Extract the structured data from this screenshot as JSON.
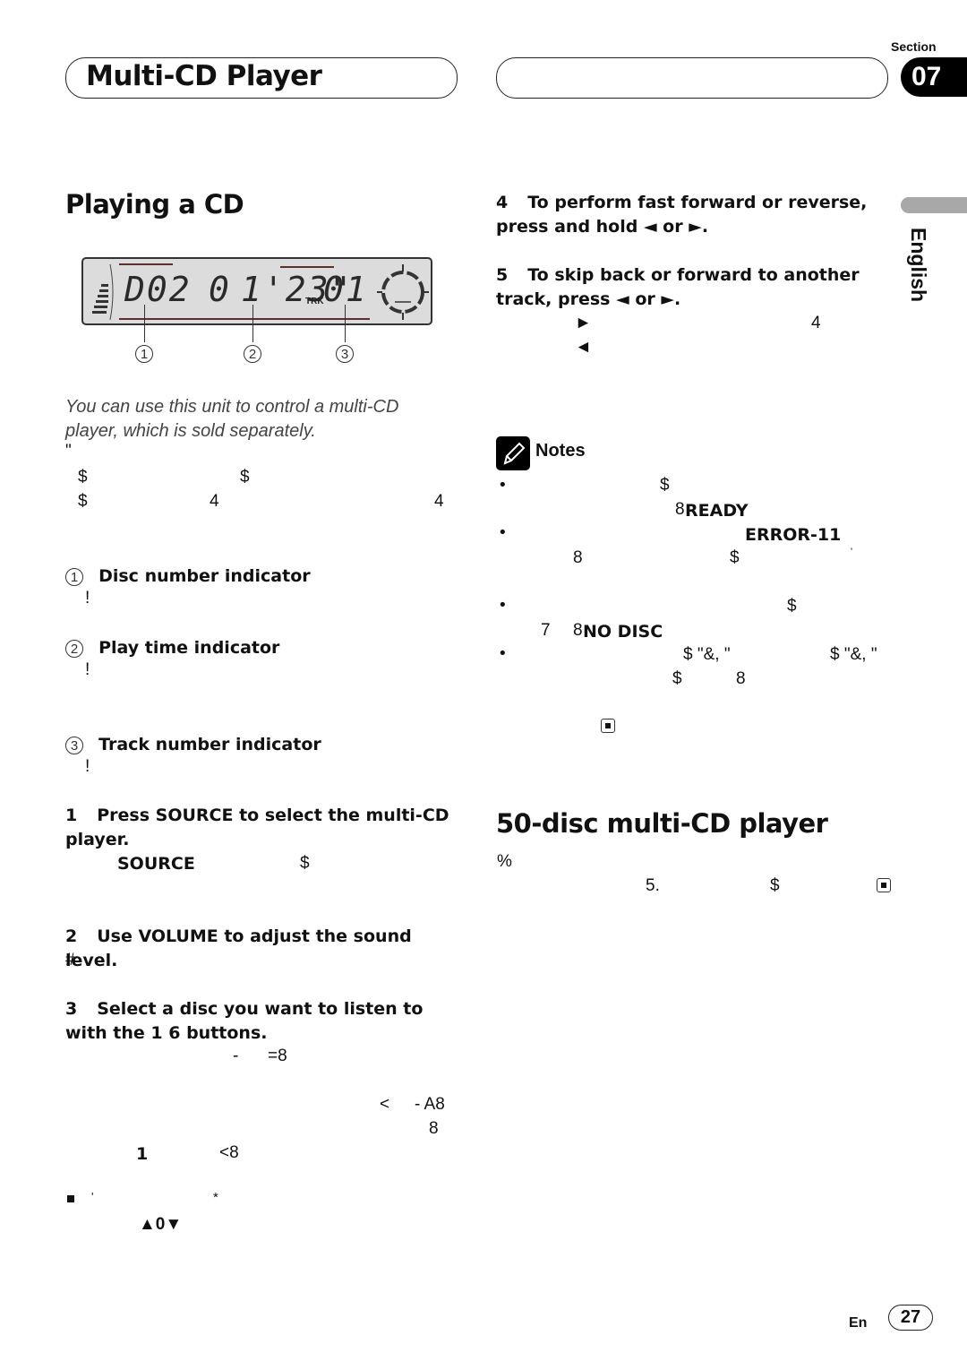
{
  "header": {
    "title": "Multi-CD Player",
    "section_label": "Section",
    "section_number": "07",
    "language_tab": "English"
  },
  "left": {
    "heading": "Playing a CD",
    "display": {
      "disc": "D02",
      "time_min": "0",
      "time_sec": "1'23\"",
      "trk_label": "TRK",
      "track": "01",
      "callouts": [
        "1",
        "2",
        "3"
      ]
    },
    "intro": "You can use this unit to control a multi-CD player, which is sold separately.",
    "fragments_intro": [
      "\"",
      "$",
      "$",
      "$",
      "4",
      "4"
    ],
    "indicators": [
      {
        "num": "1",
        "title": "Disc number indicator",
        "desc": "!"
      },
      {
        "num": "2",
        "title": "Play time indicator",
        "desc": "!"
      },
      {
        "num": "3",
        "title": "Track number indicator",
        "desc": "!"
      }
    ],
    "steps": [
      {
        "num": "1",
        "title": "Press SOURCE to select the multi-CD player.",
        "frag_bold": "SOURCE",
        "frag": "$"
      },
      {
        "num": "2",
        "title": "Use VOLUME to adjust the sound level.",
        "frag": "#"
      },
      {
        "num": "3",
        "title": "Select a disc you want to listen to with the 1  6 buttons.",
        "frags": [
          "-",
          "=8",
          "<",
          "- A8",
          "8",
          "1",
          "<8"
        ]
      }
    ],
    "footnote": {
      "bullet": "■",
      "apos": "'",
      "star": "*",
      "arrows": "▲0▼"
    }
  },
  "right": {
    "steps": [
      {
        "num": "4",
        "title": "To perform fast forward or reverse, press and hold ◄ or ►."
      },
      {
        "num": "5",
        "title": "To skip back or forward to another track, press ◄ or ►.",
        "frags": [
          "►",
          "4",
          "◄"
        ]
      }
    ],
    "notes_title": "Notes",
    "notes": [
      {
        "frags": [
          "$",
          "8",
          "READY"
        ]
      },
      {
        "frags": [
          "ERROR-11",
          "8",
          "$",
          "'"
        ]
      },
      {
        "frags": [
          "$",
          "7",
          "8",
          "NO DISC"
        ]
      },
      {
        "frags": [
          "$ \"&, \"",
          "$ \"&, \"",
          "$",
          "8"
        ]
      }
    ],
    "heading2": "50-disc multi-CD player",
    "frags2": [
      "%",
      "5.",
      "$"
    ]
  },
  "footer": {
    "lang_code": "En",
    "page": "27"
  }
}
